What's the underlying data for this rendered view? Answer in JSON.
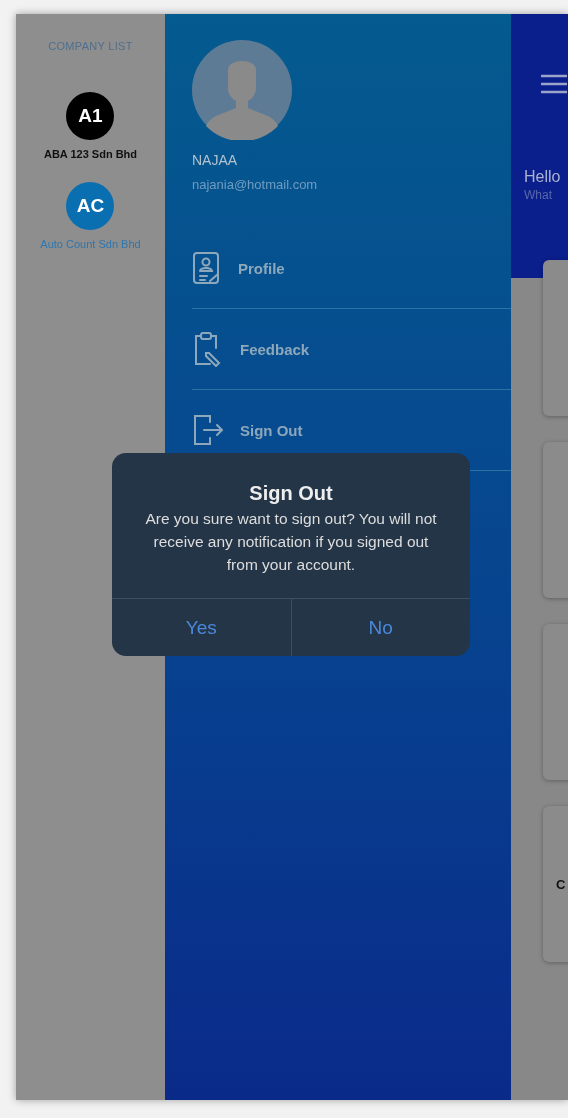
{
  "company_list": {
    "title": "COMPANY LIST",
    "companies": [
      {
        "initials": "A1",
        "name": "ABA 123 Sdn Bhd",
        "color": "#000000",
        "selected": true
      },
      {
        "initials": "AC",
        "name": "Auto Count Sdn Bhd",
        "color": "#0a6fb0",
        "selected": false
      }
    ]
  },
  "drawer": {
    "user_name": "NAJAA",
    "email": "najania@hotmail.com",
    "menu": [
      {
        "label": "Profile",
        "kind": "profile"
      },
      {
        "label": "Feedback",
        "kind": "feedback"
      },
      {
        "label": "Sign Out",
        "kind": "signout"
      }
    ]
  },
  "main": {
    "greeting": "Hello",
    "subtitle": "What",
    "card_text": "C"
  },
  "dialog": {
    "title": "Sign Out",
    "message": "Are you sure want to sign out? You will not receive any notification if you signed out from your account.",
    "buttons": [
      "Yes",
      "No"
    ]
  }
}
